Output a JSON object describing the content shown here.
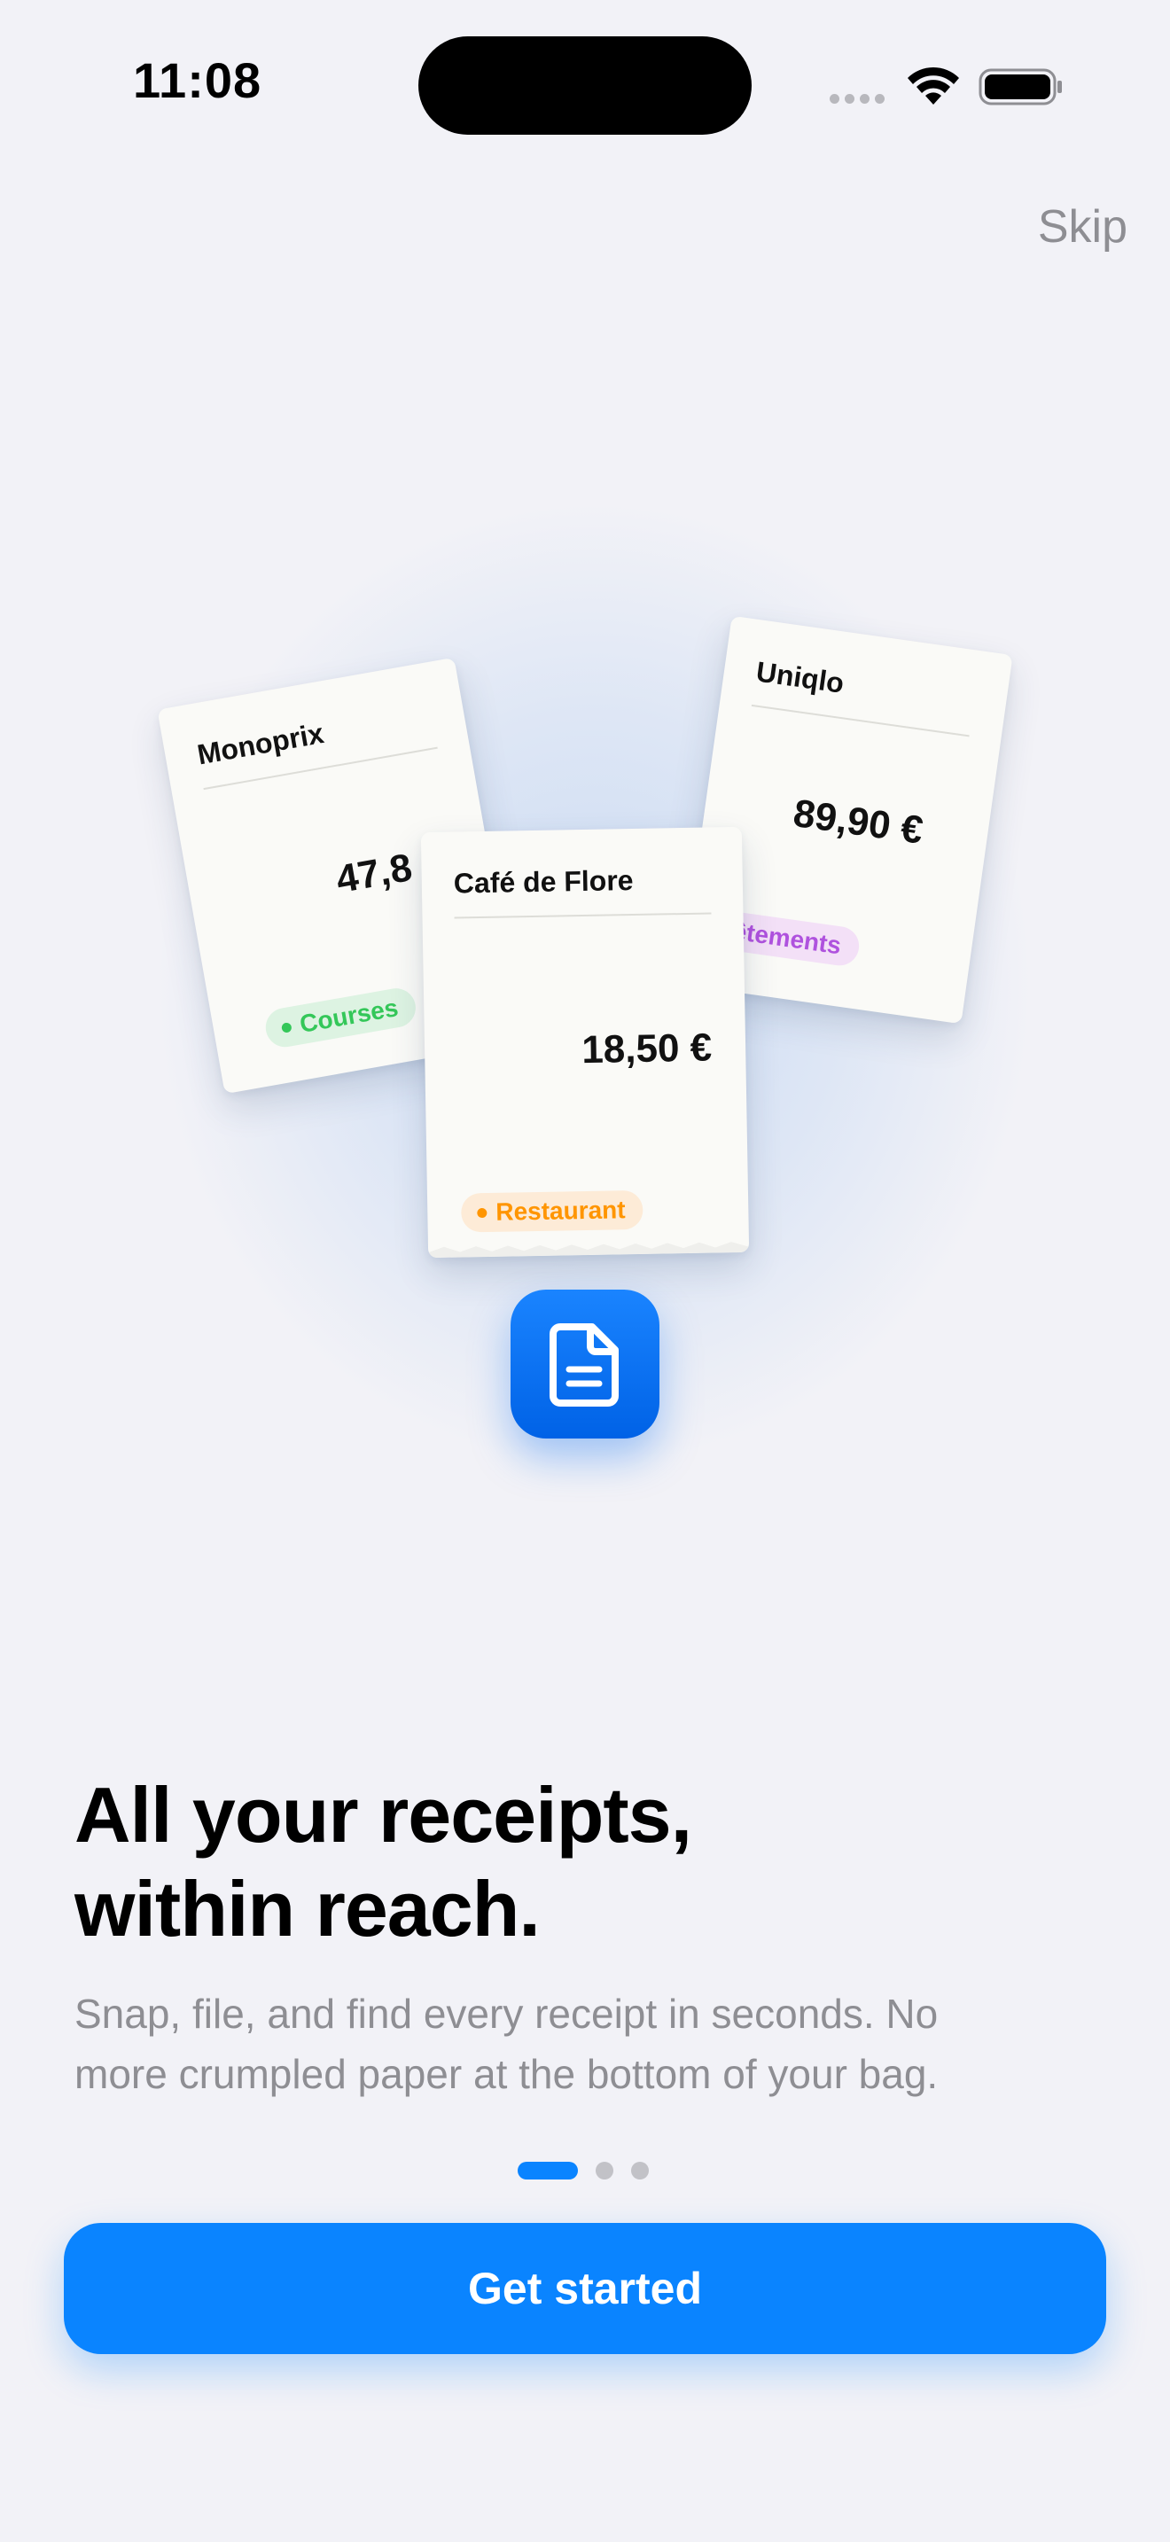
{
  "status_bar": {
    "time": "11:08"
  },
  "header": {
    "skip_label": "Skip"
  },
  "illustration": {
    "receipts": [
      {
        "merchant": "Monoprix",
        "amount": "47,8",
        "category": "Courses",
        "category_color": "#34C759",
        "category_bg": "#DDF3E2"
      },
      {
        "merchant": "Uniqlo",
        "amount": "89,90 €",
        "category": "Vêtements",
        "category_color": "#AF52DE",
        "category_bg": "#F3E0F7"
      },
      {
        "merchant": "Café de Flore",
        "amount": "18,50 €",
        "category": "Restaurant",
        "category_color": "#FF9500",
        "category_bg": "#FDEBD7"
      }
    ],
    "app_icon": "document-icon"
  },
  "content": {
    "headline_line1": "All your receipts,",
    "headline_line2": "within reach.",
    "subtitle_line1": "Snap, file, and find every receipt in seconds. No",
    "subtitle_line2": "more crumpled paper at the bottom of your bag."
  },
  "pager": {
    "current_page": 1,
    "page_count": 3
  },
  "cta": {
    "label": "Get started"
  },
  "colors": {
    "accent": "#0A84FF",
    "background": "#F2F2F7",
    "secondary_text": "#8E8E93"
  }
}
